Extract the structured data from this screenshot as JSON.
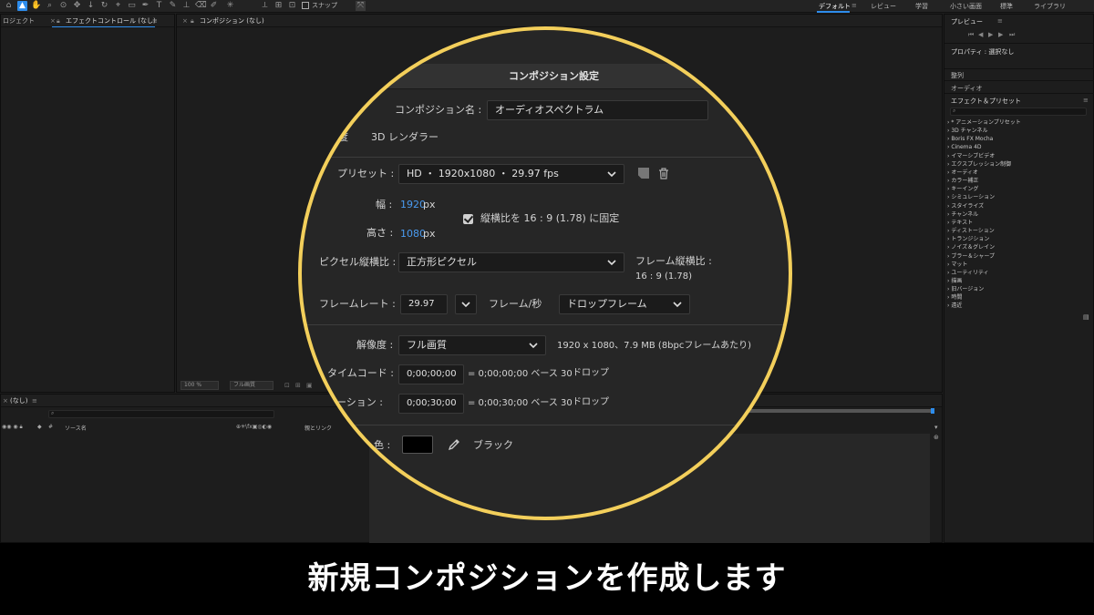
{
  "toolbar": {
    "snap_label": "スナップ",
    "workspaces": [
      {
        "label": "デフォルト",
        "active": true
      },
      {
        "label": "レビュー",
        "active": false
      },
      {
        "label": "学習",
        "active": false
      },
      {
        "label": "小さい画面",
        "active": false
      },
      {
        "label": "標準",
        "active": false
      },
      {
        "label": "ライブラリ",
        "active": false
      }
    ]
  },
  "panels": {
    "project_tab": "ロジェクト",
    "effect_controls_tab": "エフェクトコントロール (なし)",
    "composition_tab": "コンポジション (なし)",
    "zoom_value": "100 %",
    "resolution_value": "フル画質",
    "timeline_tab": "(なし)",
    "source_name_header": "ソース名",
    "parent_link_header": "親とリンク"
  },
  "right_panel": {
    "preview_title": "プレビュー",
    "properties_title": "プロパティ : 選択なし",
    "align_label": "整列",
    "audio_label": "オーディオ",
    "effects_title": "エフェクト＆プリセット",
    "effect_categories": [
      "* アニメーションプリセット",
      "3D チャンネル",
      "Boris FX Mocha",
      "Cinema 4D",
      "イマーシブビデオ",
      "エクスプレッション制御",
      "オーディオ",
      "カラー補正",
      "キーイング",
      "シミュレーション",
      "スタイライズ",
      "チャンネル",
      "テキスト",
      "ディストーション",
      "トランジション",
      "ノイズ＆グレイン",
      "ブラー＆シャープ",
      "マット",
      "ユーティリティ",
      "描画",
      "旧バージョン",
      "時間",
      "遠近"
    ]
  },
  "dialog": {
    "title": "コンポジション設定",
    "comp_name_label": "コンポジション名 :",
    "comp_name_value": "オーディオスペクトラム",
    "renderer_label_partial": "度",
    "renderer_value": "3D レンダラー",
    "preset_label": "プリセット :",
    "preset_value": "HD ・ 1920x1080 ・ 29.97 fps",
    "width_label": "幅 :",
    "width_value": "1920",
    "width_unit": "px",
    "height_label": "高さ :",
    "height_value": "1080",
    "height_unit": "px",
    "lock_aspect_label": "縦横比を 16 : 9 (1.78) に固定",
    "lock_aspect_checked": true,
    "pixel_aspect_label": "ピクセル縦横比 :",
    "pixel_aspect_value": "正方形ピクセル",
    "frame_aspect_label": "フレーム縦横比 :",
    "frame_aspect_value": "16 : 9 (1.78)",
    "frame_rate_label": "フレームレート :",
    "frame_rate_value": "29.97",
    "frame_rate_unit": "フレーム/秒",
    "drop_frame_value": "ドロップフレーム",
    "resolution_label": "解像度 :",
    "resolution_value": "フル画質",
    "resolution_info": "1920 x 1080、7.9 MB (8bpcフレームあたり)",
    "timecode_label": "タイムコード :",
    "timecode_value": "0;00;00;00",
    "timecode_info": "= 0;00;00;00  ベース 30",
    "timecode_drop": "ドロップ",
    "duration_label": "ーション :",
    "duration_value": "0;00;30;00",
    "duration_info": "= 0;00;30;00  ベース 30",
    "duration_drop": "ドロップ",
    "bg_color_label": "色 :",
    "bg_color_name": "ブラック",
    "bg_color": "#000000"
  },
  "caption": "新規コンポジションを作成します",
  "colors": {
    "accent_blue": "#2d8ceb",
    "ring_yellow": "#f3cf5b"
  }
}
